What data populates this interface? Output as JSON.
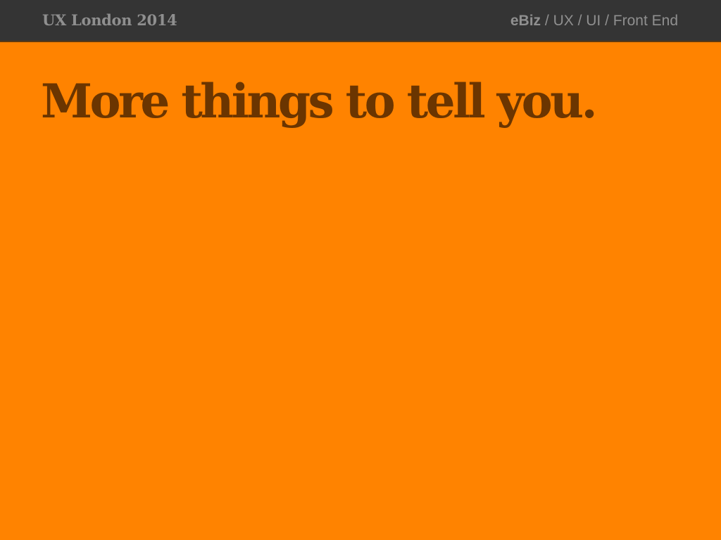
{
  "header": {
    "brand": "UX London 2014",
    "breadcrumb": [
      {
        "label": "eBiz",
        "emphasis": true
      },
      {
        "label": "UX",
        "emphasis": false
      },
      {
        "label": "UI",
        "emphasis": false
      },
      {
        "label": "Front End",
        "emphasis": false
      }
    ],
    "separator": " / "
  },
  "slide": {
    "title": "More things to tell you."
  },
  "colors": {
    "background": "#ff8300",
    "topbar": "#343434",
    "header_text": "#8f8f8f",
    "title_text": "#6b3500"
  }
}
